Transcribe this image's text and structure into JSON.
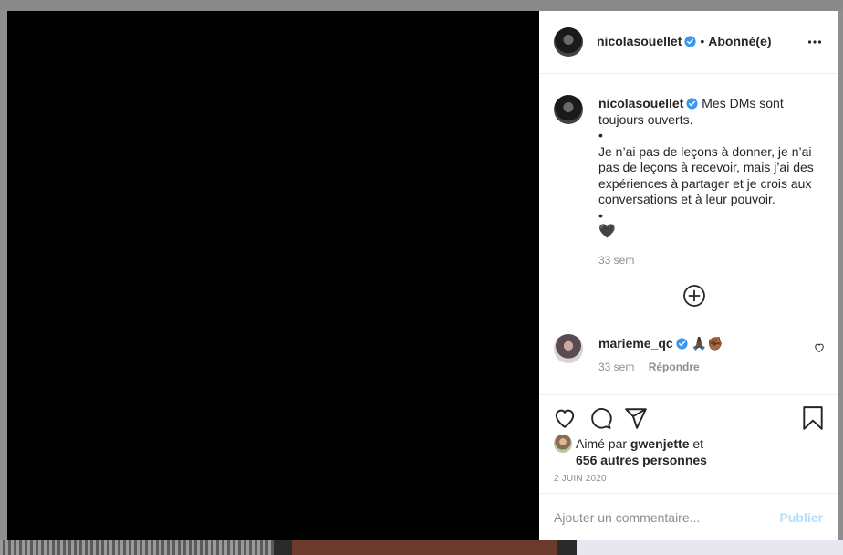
{
  "colors": {
    "accent": "#0095f6",
    "publish_disabled": "#b2dffc",
    "muted": "#8e8e8e",
    "text": "#262626"
  },
  "header": {
    "username": "nicolasouellet",
    "separator": "•",
    "follow_status": "Abonné(e)",
    "more_icon": "more-horizontal-icon"
  },
  "caption": {
    "username": "nicolasouellet",
    "first_line": "Mes DMs sont toujours ouverts.",
    "bullet_1": "•",
    "body": "Je n’ai pas de leçons à donner, je n’ai pas de leçons à recevoir, mais j’ai des expériences à partager et je crois aux conversations et à leur pouvoir.",
    "bullet_2": "•",
    "emoji": "🖤",
    "time": "33 sem"
  },
  "load_more_icon": "plus-circle-icon",
  "comments": [
    {
      "username": "marieme_qc",
      "text": "🙏🏿✊🏾",
      "time": "33 sem",
      "reply": "Répondre",
      "like_icon": "heart-small-icon"
    }
  ],
  "actions": {
    "icons": [
      "heart-icon",
      "comment-icon",
      "share-icon",
      "bookmark-icon"
    ],
    "liked_by_prefix": "Aimé par",
    "liked_by_user": "gwenjette",
    "liked_by_and": "et",
    "others": "656 autres personnes",
    "date": "2 JUIN 2020"
  },
  "comment_box": {
    "placeholder": "Ajouter un commentaire...",
    "publish": "Publier"
  }
}
